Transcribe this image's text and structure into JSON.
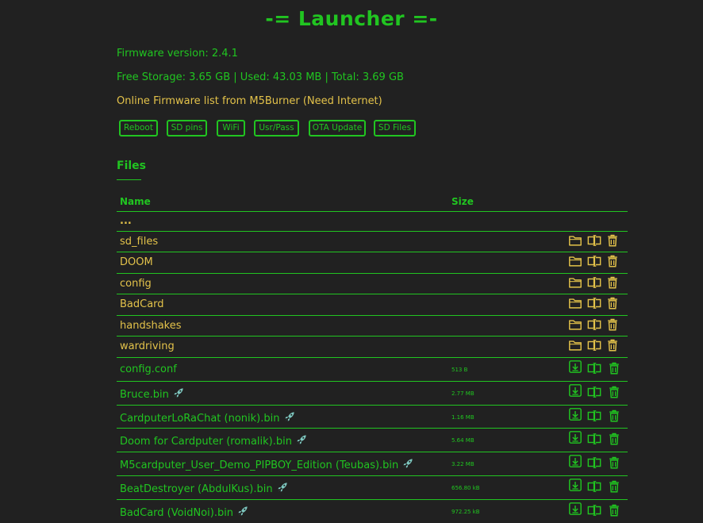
{
  "header": {
    "title": "-= Launcher =-"
  },
  "info": {
    "firmware": "Firmware version: 2.4.1",
    "storage": "Free Storage: 3.65 GB | Used: 43.03 MB | Total: 3.69 GB",
    "online_link": "Online Firmware list from M5Burner (Need Internet)"
  },
  "buttons": [
    {
      "label": "Reboot"
    },
    {
      "label": "SD pins"
    },
    {
      "label": "WiFi"
    },
    {
      "label": "Usr/Pass"
    },
    {
      "label": "OTA Update"
    },
    {
      "label": "SD Files"
    }
  ],
  "files_section": {
    "heading": "Files",
    "columns": {
      "name": "Name",
      "size": "Size"
    },
    "parent_dir": "...",
    "rows": [
      {
        "name": "sd_files",
        "type": "dir",
        "size": ""
      },
      {
        "name": "DOOM",
        "type": "dir",
        "size": ""
      },
      {
        "name": "config",
        "type": "dir",
        "size": ""
      },
      {
        "name": "BadCard",
        "type": "dir",
        "size": ""
      },
      {
        "name": "handshakes",
        "type": "dir",
        "size": ""
      },
      {
        "name": "wardriving",
        "type": "dir",
        "size": ""
      },
      {
        "name": "config.conf",
        "type": "file",
        "size": "513 B",
        "installable": false
      },
      {
        "name": "Bruce.bin",
        "type": "file",
        "size": "2.77 MB",
        "installable": true
      },
      {
        "name": "CardputerLoRaChat (nonik).bin",
        "type": "file",
        "size": "1.16 MB",
        "installable": true
      },
      {
        "name": "Doom for Cardputer (romalik).bin",
        "type": "file",
        "size": "5.64 MB",
        "installable": true
      },
      {
        "name": "M5cardputer_User_Demo_PIPBOY_Edition (Teubas).bin",
        "type": "file",
        "size": "3.22 MB",
        "installable": true
      },
      {
        "name": "BeatDestroyer (AbdulKus).bin",
        "type": "file",
        "size": "656.80 kB",
        "installable": true
      },
      {
        "name": "BadCard (VoidNoi).bin",
        "type": "file",
        "size": "972.25 kB",
        "installable": true
      }
    ]
  },
  "icons": {
    "folder": "folder-icon",
    "rename": "rename-icon",
    "delete": "trash-icon",
    "download": "download-icon",
    "install": "rocket-icon"
  },
  "colors": {
    "background": "#212121",
    "green": "#21c521",
    "yellow": "#e3c24a"
  }
}
